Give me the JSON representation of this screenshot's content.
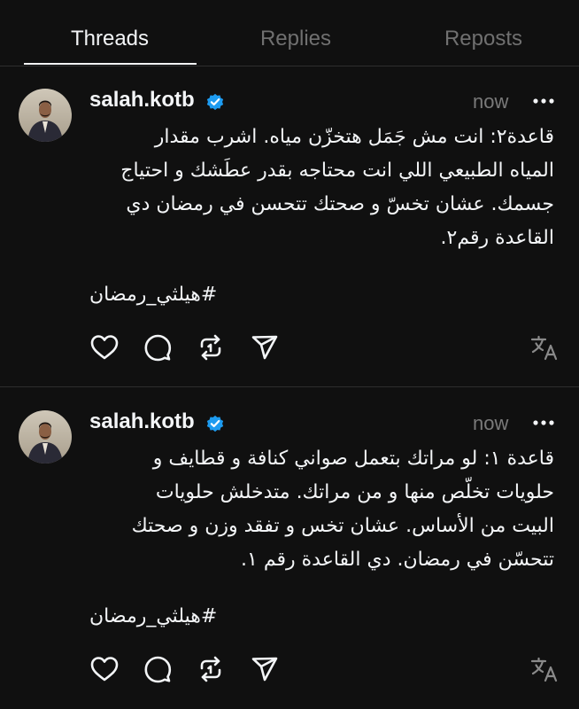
{
  "tabs": [
    {
      "label": "Threads",
      "active": true
    },
    {
      "label": "Replies",
      "active": false
    },
    {
      "label": "Reposts",
      "active": false
    }
  ],
  "posts": [
    {
      "username": "salah.kotb",
      "verified": true,
      "time": "now",
      "lines": [
        "قاعدة٢: انت مش جَمَل هتخزّن مياه. اشرب مقدار",
        "المياه الطبيعي اللي انت محتاجه بقدر عطَشك و احتياج",
        "جسمك. عشان تخسّ و صحتك تتحسن في رمضان دي",
        "القاعدة رقم٢."
      ],
      "hashtag": "#هيلثي_رمضان"
    },
    {
      "username": "salah.kotb",
      "verified": true,
      "time": "now",
      "lines": [
        "قاعدة ١: لو مراتك بتعمل صواني كنافة و قطايف و",
        "حلويات تخلّص منها و من مراتك. متدخلش حلويات",
        "البيت من الأساس. عشان تخس و تفقد وزن و صحتك",
        "تتحسّن في رمضان. دي القاعدة رقم ١."
      ],
      "hashtag": "#هيلثي_رمضان"
    }
  ],
  "colors": {
    "background": "#101010",
    "text": "#f3f5f7",
    "muted": "#707070",
    "verified": "#1d9bf0",
    "divider": "#2e2e2e"
  },
  "icons": {
    "like": "heart-icon",
    "reply": "comment-icon",
    "repost": "repost-icon",
    "share": "share-icon",
    "translate": "translate-icon",
    "more": "more-icon",
    "verified": "verified-badge-icon"
  }
}
